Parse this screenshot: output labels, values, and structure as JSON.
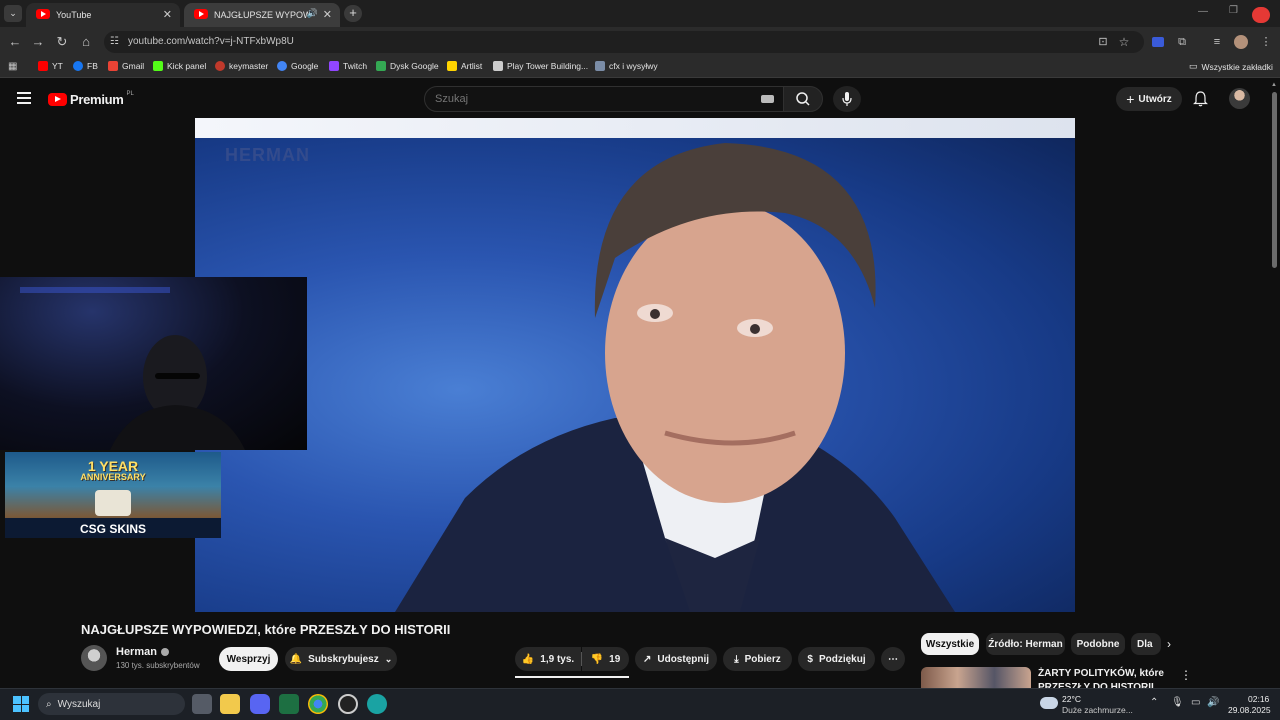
{
  "browser": {
    "tabs": [
      {
        "label": "YouTube"
      },
      {
        "label": "NAJGŁUPSZE WYPOWIEDZI",
        "audio_icon": "speaker-icon"
      }
    ],
    "new_tab": "+",
    "url": "youtube.com/watch?v=j-NTFxbWp8U",
    "bookmarks": [
      {
        "label": "YT",
        "color": "#ff0000"
      },
      {
        "label": "FB",
        "color": "#1877f2"
      },
      {
        "label": "Gmail",
        "color": "#ea4335"
      },
      {
        "label": "Kick panel",
        "color": "#53fc18"
      },
      {
        "label": "keymaster",
        "color": "#c0392b"
      },
      {
        "label": "Google",
        "color": "#4285f4"
      },
      {
        "label": "Twitch",
        "color": "#9146ff"
      },
      {
        "label": "Dysk Google",
        "color": "#34a853"
      },
      {
        "label": "Artlist",
        "color": "#ffd400"
      },
      {
        "label": "Play Tower Building...",
        "color": "#cccccc"
      },
      {
        "label": "cfx i wysyłwy",
        "color": "#7a8ca6"
      }
    ],
    "all_bookmarks": "Wszystkie zakładki"
  },
  "youtube": {
    "logo_text": "Premium",
    "region": "PL",
    "search_placeholder": "Szukaj",
    "create_label": "Utwórz",
    "video_watermark": "HERMAN",
    "promo_line1": "1 YEAR",
    "promo_line2": "ANNIVERSARY",
    "promo_brand": "CSG SKINS",
    "title": "NAJGŁUPSZE WYPOWIEDZI, które PRZESZŁY DO HISTORII",
    "channel": {
      "name": "Herman",
      "subscribers": "130 tys. subskrybentów"
    },
    "support_label": "Wesprzyj",
    "subscribed_label": "Subskrybujesz",
    "likes": "1,9 tys.",
    "dislikes": "19",
    "share_label": "Udostępnij",
    "download_label": "Pobierz",
    "thanks_label": "Podziękuj",
    "chips": [
      "Wszystkie",
      "Źródło: Herman",
      "Podobne",
      "Dla"
    ],
    "recommended": {
      "title_line1": "ŻARTY POLITYKÓW, które",
      "title_line2": "PRZESZŁY DO HISTORII"
    }
  },
  "taskbar": {
    "search_placeholder": "Wyszukaj",
    "weather_temp": "22°C",
    "weather_desc": "Duże zachmurze...",
    "time": "02:16",
    "date": "29.08.2025"
  },
  "colors": {
    "accent": "#ff0000",
    "bg": "#0f0f0f"
  }
}
